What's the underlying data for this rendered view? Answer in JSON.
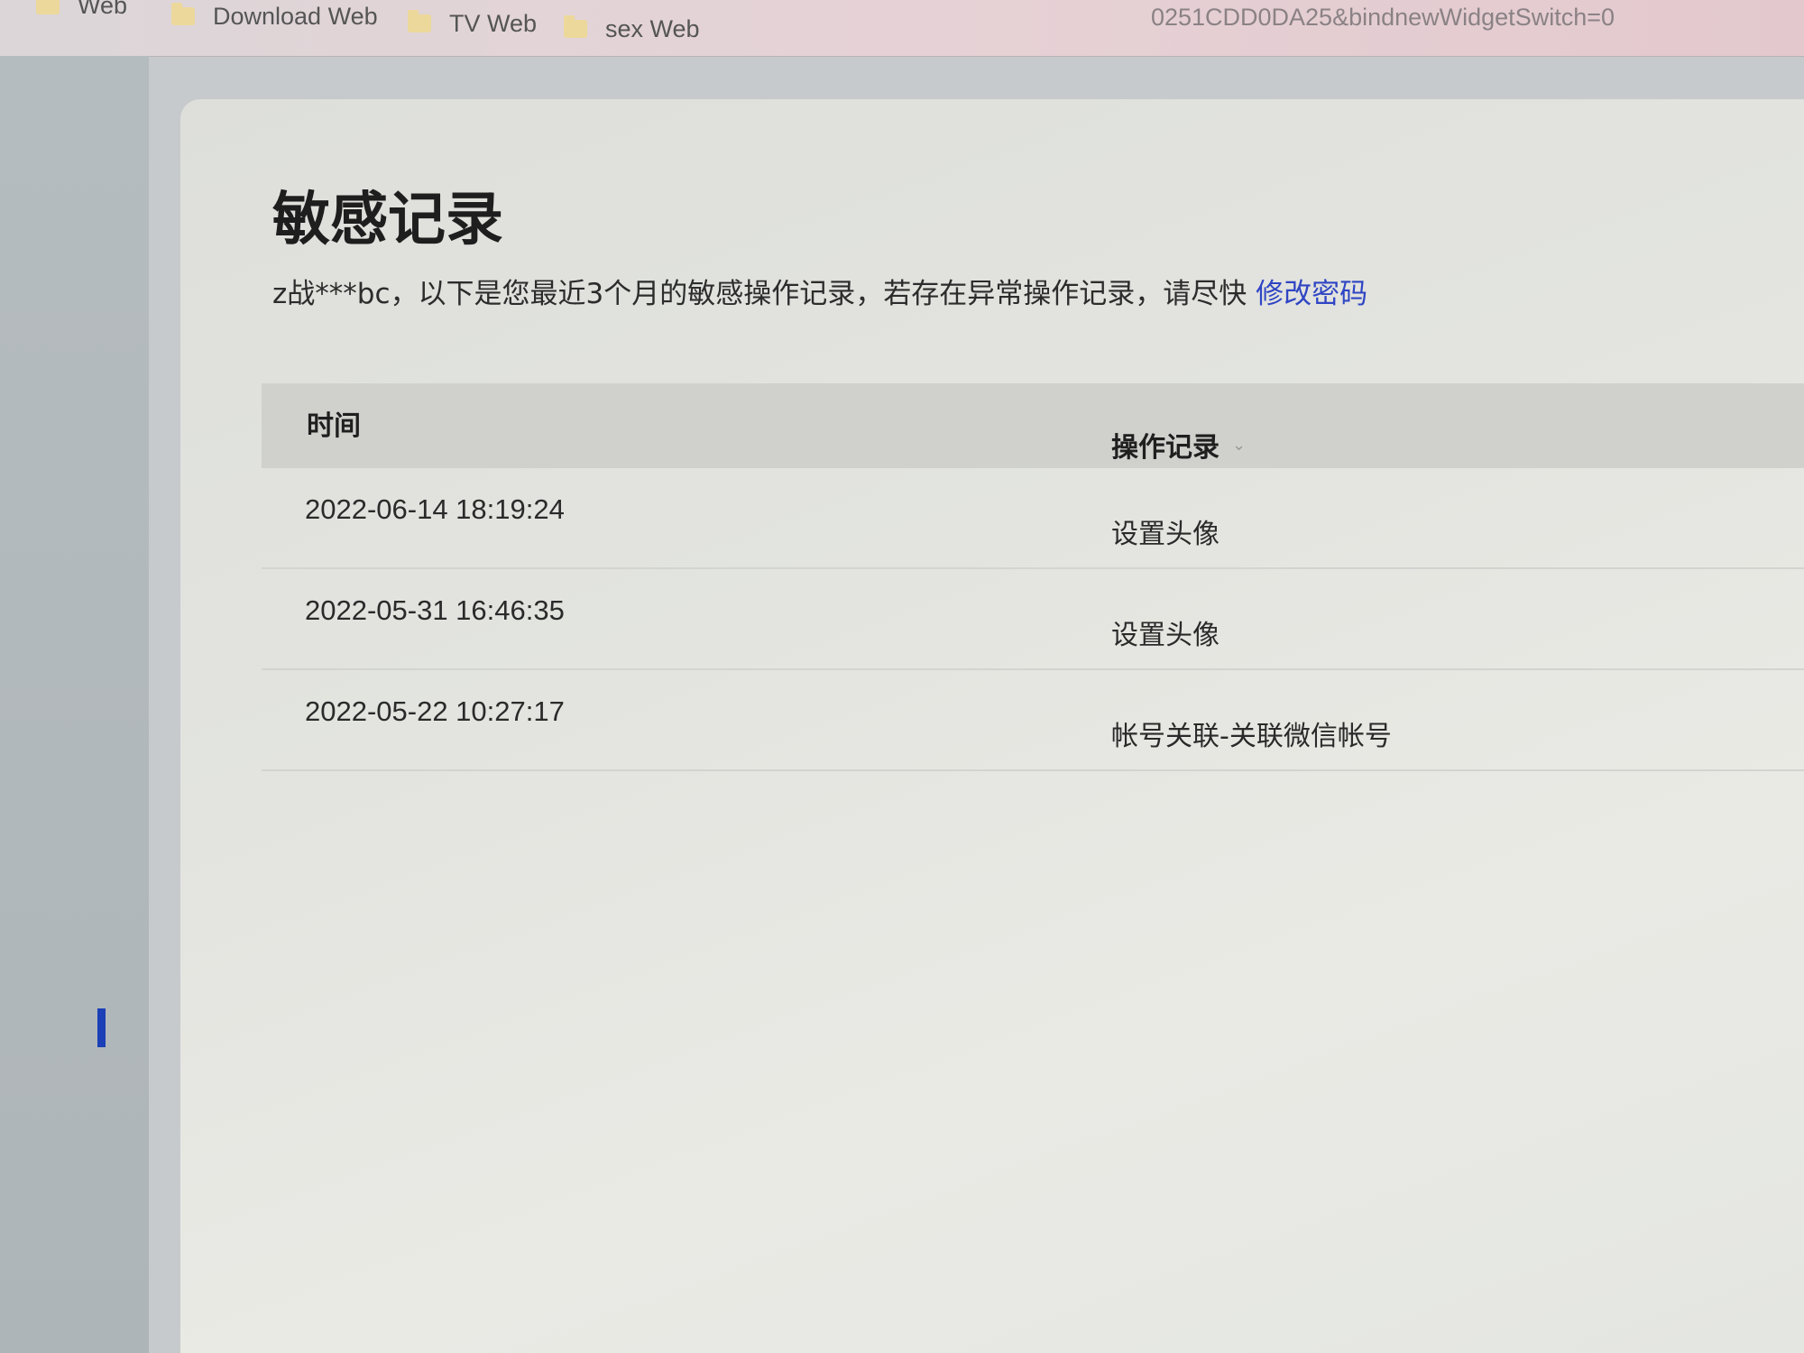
{
  "bookmarks_bar": {
    "items": [
      {
        "label": "Web"
      },
      {
        "label": "Download Web"
      },
      {
        "label": "TV Web"
      },
      {
        "label": "sex Web"
      }
    ],
    "url_fragment": "0251CDD0DA25&bindnewWidgetSwitch=0"
  },
  "page": {
    "title": "敏感记录",
    "intro": "z战***bc，以下是您最近3个月的敏感操作记录，若存在异常操作记录，请尽快",
    "change_password_link": "修改密码"
  },
  "table": {
    "columns": {
      "time": "时间",
      "operation": "操作记录"
    },
    "rows": [
      {
        "time": "2022-06-14 18:19:24",
        "operation": "设置头像"
      },
      {
        "time": "2022-05-31 16:46:35",
        "operation": "设置头像"
      },
      {
        "time": "2022-05-22 10:27:17",
        "operation": "帐号关联-关联微信帐号"
      }
    ]
  },
  "colors": {
    "link": "#2f45c4",
    "side_marker": "#1a3fb6"
  },
  "icons": {
    "bookmark": "folder-icon",
    "sort": "chevron-down-icon"
  }
}
